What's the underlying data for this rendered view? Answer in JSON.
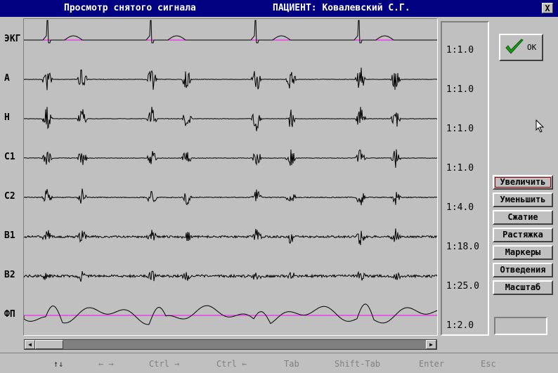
{
  "window": {
    "title": "Просмотр снятого сигнала",
    "patient": "ПАЦИЕНТ: Ковалевский С.Г.",
    "close_label": "X"
  },
  "channels": [
    {
      "label": "ЭКГ",
      "scale": "1:1.0"
    },
    {
      "label": "A",
      "scale": "1:1.0"
    },
    {
      "label": "H",
      "scale": "1:1.0"
    },
    {
      "label": "C1",
      "scale": "1:1.0"
    },
    {
      "label": "C2",
      "scale": "1:4.0"
    },
    {
      "label": "B1",
      "scale": "1:18.0"
    },
    {
      "label": "B2",
      "scale": "1:25.0"
    },
    {
      "label": "ФП",
      "scale": "1:2.0"
    }
  ],
  "buttons": {
    "ok": "OK",
    "zoom_in": "Увеличить",
    "zoom_out": "Уменьшить",
    "compress": "Сжатие",
    "stretch": "Растяжка",
    "markers": "Маркеры",
    "leads": "Отведения",
    "scale": "Масштаб"
  },
  "status_hints": [
    {
      "key": "↑↓"
    },
    {
      "key": "← →"
    },
    {
      "key": "Ctrl →"
    },
    {
      "key": "Ctrl ←"
    },
    {
      "key": "Tab"
    },
    {
      "key": "Shift-Tab"
    },
    {
      "key": "Enter"
    },
    {
      "key": "Esc"
    }
  ],
  "colors": {
    "titlebar": "#000080",
    "background": "#c0c0c0",
    "trace": "#000000",
    "baseline_marker": "#ff00ff",
    "ok_check": "#1a9a1a"
  },
  "icons": {
    "ok": "check-icon",
    "close": "close-icon",
    "scroll_left": "triangle-left-icon",
    "scroll_right": "triangle-right-icon"
  }
}
